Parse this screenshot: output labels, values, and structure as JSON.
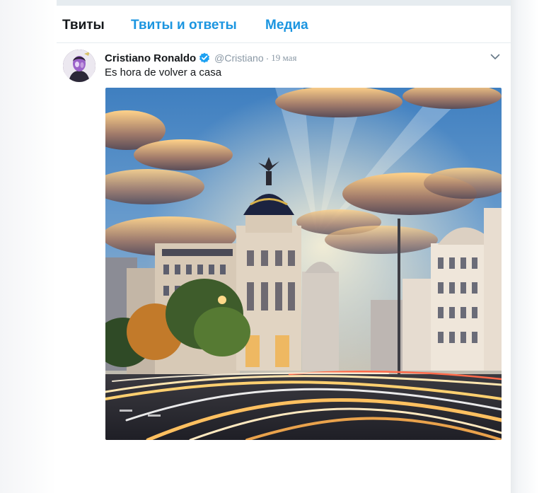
{
  "tabs": [
    {
      "label": "Твиты",
      "active": true
    },
    {
      "label": "Твиты и ответы",
      "active": false
    },
    {
      "label": "Медиа",
      "active": false
    }
  ],
  "tweet": {
    "author_name": "Cristiano Ronaldo",
    "handle": "@Cristiano",
    "separator": "·",
    "timestamp": "19 мая",
    "verified": true,
    "text": "Es hora de volver a casa",
    "media_alt": "Madrid, Metropolis building on Gran Vía at sunset with light trails"
  },
  "colors": {
    "accent": "#1b95e0",
    "text": "#14171a",
    "muted": "#8a98a5",
    "verified_badge": "#1da1f2"
  },
  "icons": {
    "verified": "verified-badge-icon",
    "caret": "chevron-down-icon"
  }
}
